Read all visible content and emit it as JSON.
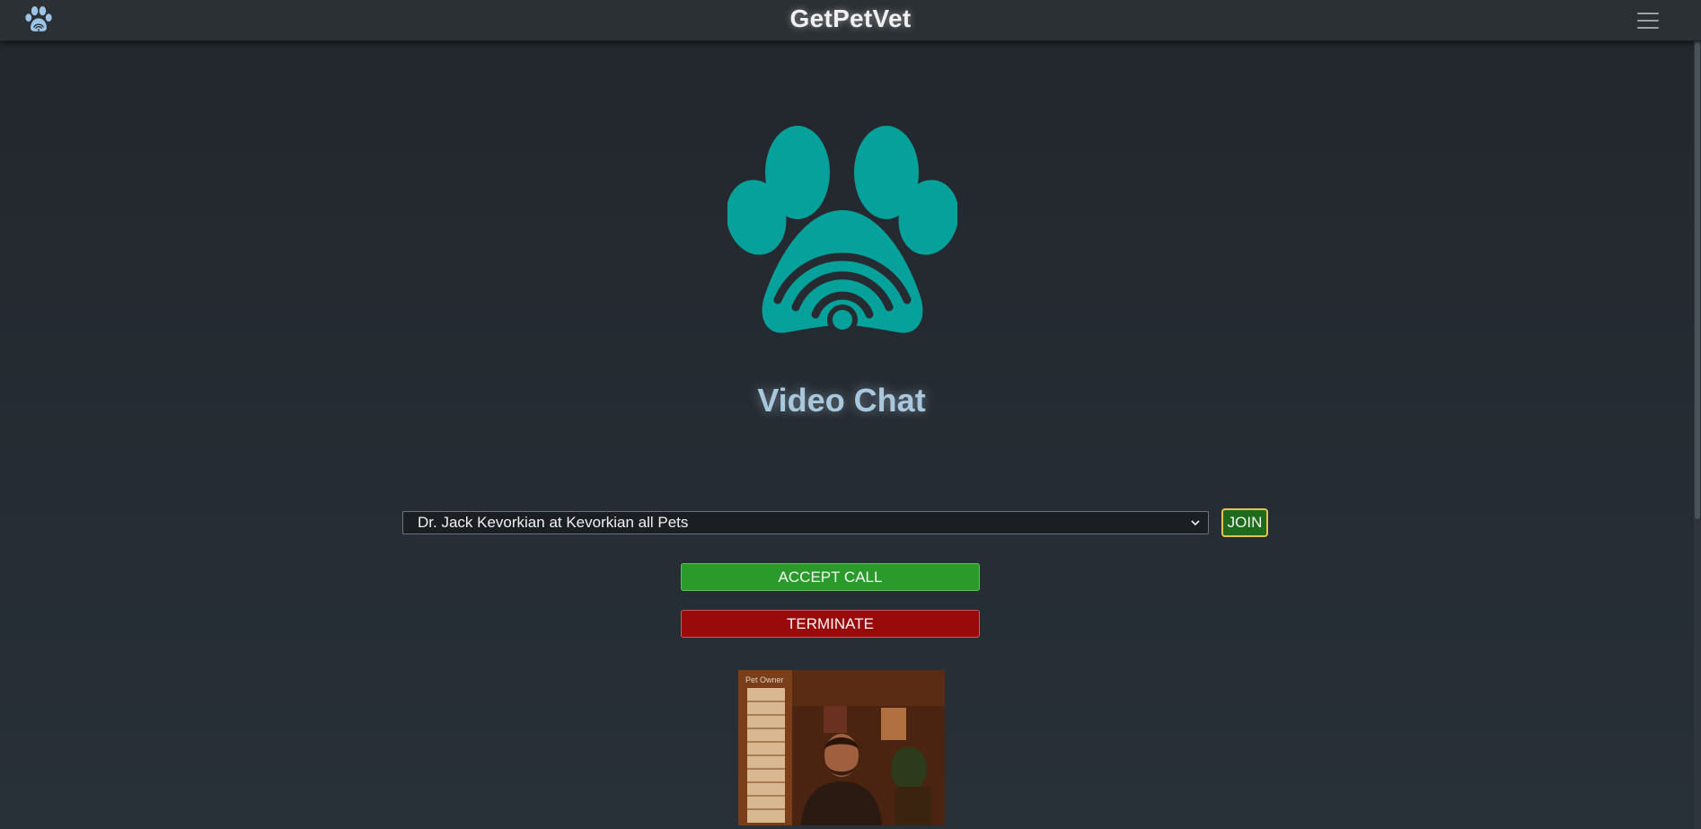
{
  "navbar": {
    "brand": "GetPetVet",
    "logo_icon": "paw-wifi-icon",
    "menu_icon": "hamburger-menu-icon"
  },
  "hero": {
    "logo_icon": "paw-wifi-logo-icon",
    "logo_color": "#05a19a",
    "title": "Video Chat"
  },
  "call_controls": {
    "vet_select_value": "Dr. Jack Kevorkian at Kevorkian all Pets",
    "join_label": "JOIN",
    "accept_label": "ACCEPT CALL",
    "terminate_label": "TERMINATE"
  },
  "video": {
    "label": "Pet Owner",
    "state": "live camera feed"
  },
  "colors": {
    "accent_teal": "#05a19a",
    "accept_green": "#2a9a2a",
    "terminate_red": "#990a0a",
    "join_border_gold": "#e9c24a"
  }
}
